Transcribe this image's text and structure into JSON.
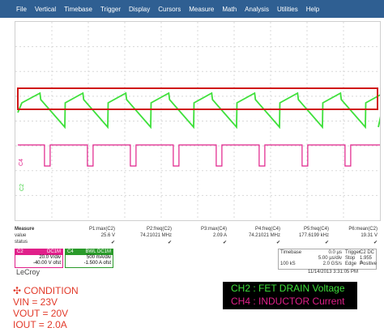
{
  "menu": [
    "File",
    "Vertical",
    "Timebase",
    "Trigger",
    "Display",
    "Cursors",
    "Measure",
    "Math",
    "Analysis",
    "Utilities",
    "Help"
  ],
  "markers": {
    "ch2": "C2",
    "ch4": "C4"
  },
  "colors": {
    "ch2": "#3ee03a",
    "ch4": "#e0208a",
    "highlight": "#d01818",
    "menubar": "#2f5f92"
  },
  "measure": {
    "row_labels": [
      "Measure",
      "value",
      "status"
    ],
    "params": [
      {
        "name": "P1:max(C2)",
        "value": "25.6 V",
        "status": "✔"
      },
      {
        "name": "P2:freq(C2)",
        "value": "74.21021 MHz",
        "status": "✔"
      },
      {
        "name": "P3:max(C4)",
        "value": "2.09 A",
        "status": "✔"
      },
      {
        "name": "P4:freq(C4)",
        "value": "74.21021 MHz",
        "status": "✔"
      },
      {
        "name": "P5:freq(C4)",
        "value": "177.6199 kHz",
        "status": "✔"
      },
      {
        "name": "P6:mean(C2)",
        "value": "19.31 V",
        "status": "✔"
      }
    ]
  },
  "channels": [
    {
      "name": "C2",
      "hdr_right": "DC1M",
      "v1": "20.0 V/div",
      "v2": "-40.00 V ofst",
      "color": "#e0208a"
    },
    {
      "name": "C4",
      "hdr_right": "BWL DC1M",
      "v1": "500 mA/div",
      "v2": "-1.500 A ofst",
      "color": "#2a9a2a"
    }
  ],
  "timebase": {
    "label": "Timebase",
    "offset": "0.0 µs",
    "trigger_label": "Trigger",
    "trigger_val": "C2 DC",
    "div": "5.00 µs/div",
    "level": "1.955 A",
    "samples": "100 kS",
    "rate": "2.0 GS/s",
    "mode": "Stop",
    "slope": "Edge",
    "polarity": "Positive"
  },
  "brand": "LeCroy",
  "timestamp": "11/14/2013 3:31:05 PM",
  "condition": {
    "title": "CONDITION",
    "lines": [
      "VIN = 23V",
      "VOUT = 20V",
      "IOUT = 2.0A"
    ]
  },
  "legend": {
    "ch2": "CH2 : FET DRAIN Voltage",
    "ch4": "CH4 : INDUCTOR Current"
  }
}
